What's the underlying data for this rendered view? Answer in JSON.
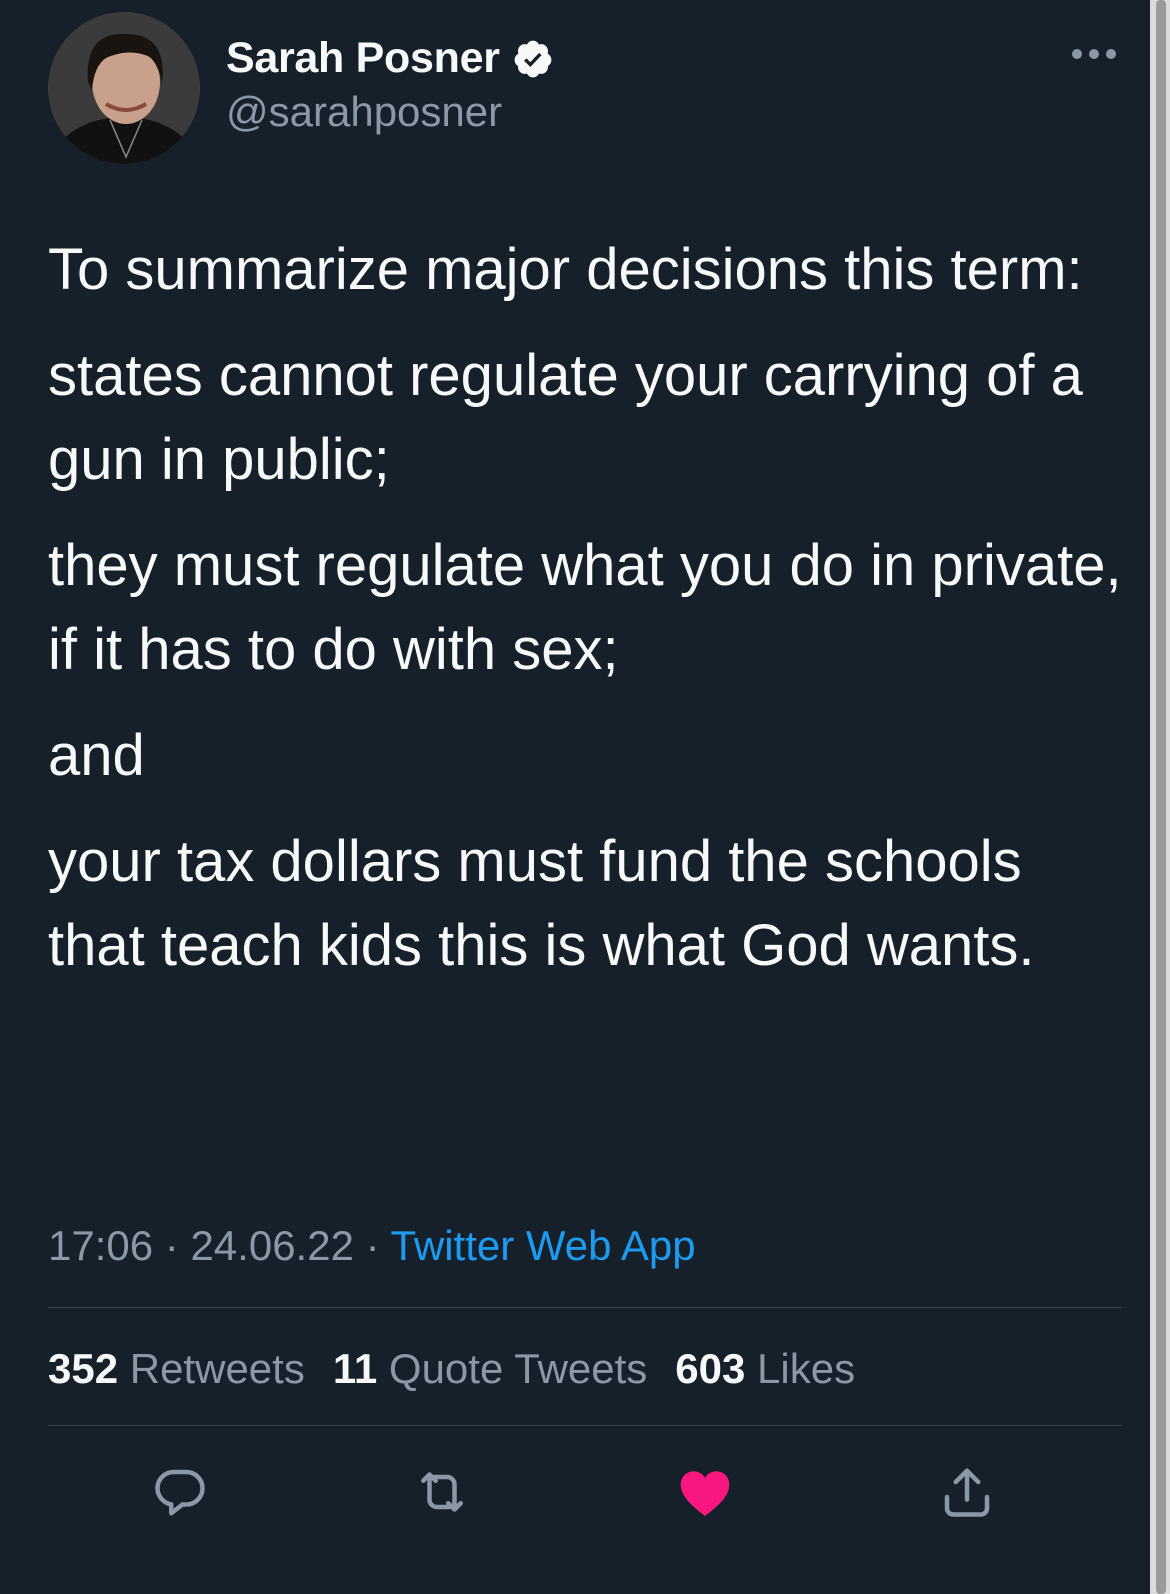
{
  "author": {
    "display_name": "Sarah Posner",
    "handle": "@sarahposner",
    "verified": true
  },
  "tweet": {
    "paragraphs": [
      "To summarize major decisions this term:",
      "states cannot regulate your carrying of a gun in public;",
      "they must regulate what you do in private, if it has to do with sex;",
      "and",
      "your tax dollars must fund the schools that teach kids this is what God wants."
    ]
  },
  "meta": {
    "time": "17:06",
    "separator": "·",
    "date": "24.06.22",
    "source": "Twitter Web App"
  },
  "stats": {
    "retweets_count": "352",
    "retweets_label": "Retweets",
    "quotes_count": "11",
    "quotes_label": "Quote Tweets",
    "likes_count": "603",
    "likes_label": "Likes"
  },
  "actions": {
    "reply_icon": "reply-icon",
    "retweet_icon": "retweet-icon",
    "like_icon": "heart-icon",
    "share_icon": "share-icon",
    "liked": true
  },
  "colors": {
    "background": "#15202b",
    "text": "#f7f9f9",
    "secondary": "#8b98a5",
    "link": "#1d9bf0",
    "like": "#f91880",
    "divider": "#38444d"
  }
}
